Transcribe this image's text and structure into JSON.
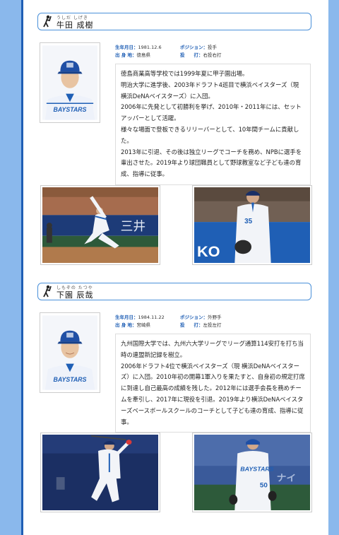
{
  "players": [
    {
      "ruby": "うしだ しげき",
      "name": "牛田 成樹",
      "birth_label": "生年月日：",
      "birth_value": "1981.12.6",
      "home_label": "出 身 地：",
      "home_value": "徳島県",
      "position_label": "ポジション：",
      "position_value": "投手",
      "throwbat_label": "投　　打：",
      "throwbat_value": "右投右打",
      "bio": [
        "徳島商業高等学校では1999年夏に甲子園出場。",
        "明治大学に進学後、2003年ドラフト4巡目で横浜ベイスターズ（現 横浜DeNAベイスターズ）に入団。",
        "2006年に先発として初勝利を挙げ、2010年・2011年には、セットアッパーとして活躍。",
        "様々な場面で登板できるリリーバーとして、10年間チームに貢献した。",
        "2013年に引退、その後は独立リーグでコーチを務め、NPBに選手を輩出させた。2019年より球団職員として野球教室など子ども達の育成、指導に従事。"
      ],
      "photo_text": "三井",
      "jersey_number": "35"
    },
    {
      "ruby": "しもぞの たつや",
      "name": "下園 辰哉",
      "birth_label": "生年月日：",
      "birth_value": "1984.11.22",
      "home_label": "出 身 地：",
      "home_value": "宮崎県",
      "position_label": "ポジション：",
      "position_value": "外野手",
      "throwbat_label": "投　　打：",
      "throwbat_value": "左投左打",
      "bio": [
        "九州国際大学では、九州六大学リーグでリーグ通算114安打を打ち当時の連盟新記録を樹立。",
        "2006年ドラフト4位で横浜ベイスターズ（現 横浜DeNAベイスターズ）に入団。2010年初の開幕1軍入りを果たすと、自身初の規定打席に到達し自己最高の成績を残した。2012年には選手会長を務めチームを牽引し、2017年に現役を引退。2019年より横浜DeNAベイスターズベースボールスクールのコーチとして子ども達の育成、指導に従事。"
      ],
      "jersey_number": "50"
    }
  ],
  "colors": {
    "accent": "#1f5fb5",
    "rail": "#8ab8ec",
    "name_border": "#4a90d9"
  },
  "icons": [
    "batter-icon"
  ]
}
